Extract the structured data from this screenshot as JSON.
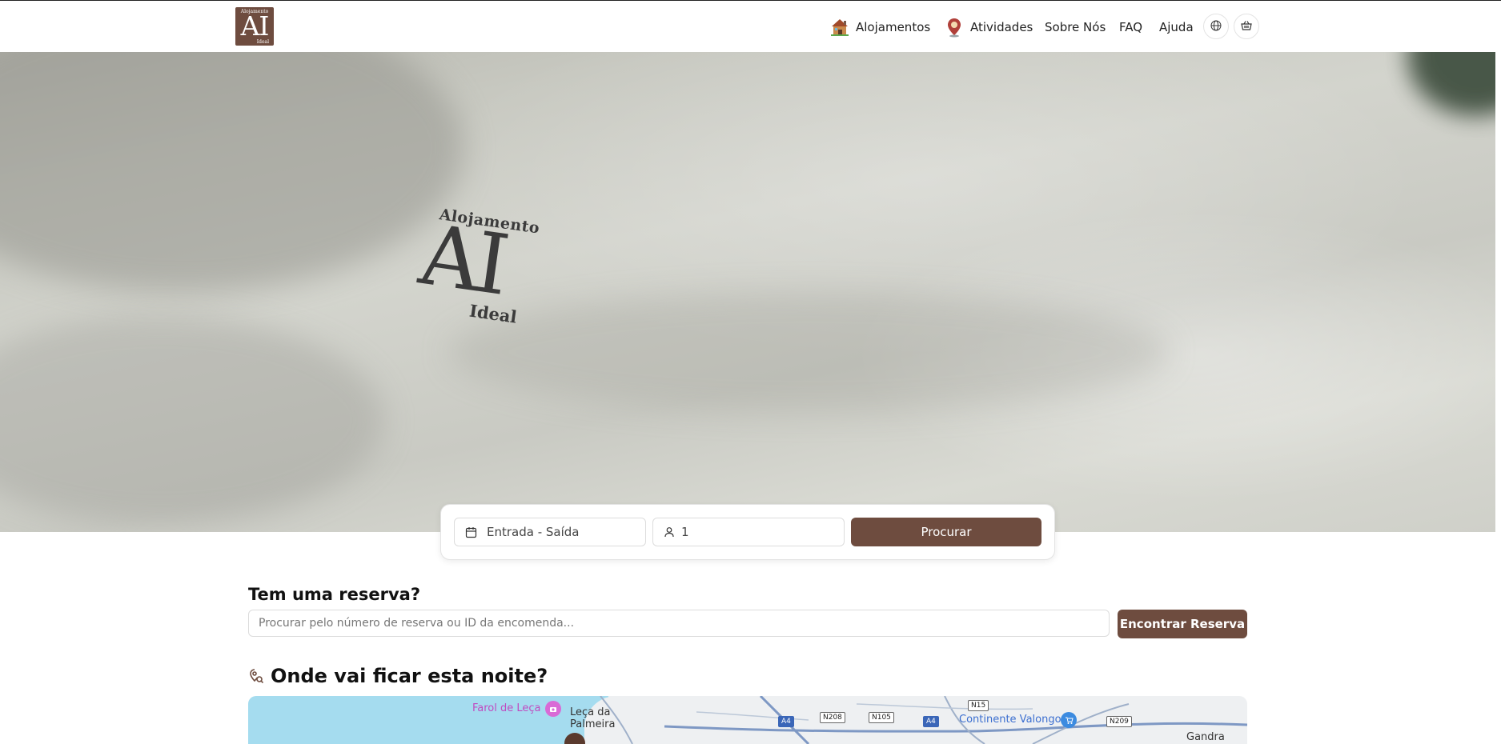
{
  "logo": {
    "top": "Alojamento",
    "main": "AI",
    "bottom": "Ideal"
  },
  "nav": {
    "items": [
      {
        "label": "Alojamentos",
        "icon": "house-icon"
      },
      {
        "label": "Atividades",
        "icon": "map-pin-icon"
      },
      {
        "label": "Sobre Nós"
      },
      {
        "label": "FAQ"
      },
      {
        "label": "Ajuda"
      }
    ],
    "language_icon": "globe-icon",
    "basket_icon": "basket-icon"
  },
  "hero": {
    "embroidery": {
      "top": "Alojamento",
      "main": "AI",
      "bottom": "Ideal"
    }
  },
  "search": {
    "dates_placeholder": "Entrada - Saída",
    "guests_value": "1",
    "search_button": "Procurar"
  },
  "reservation": {
    "title": "Tem uma reserva?",
    "placeholder": "Procurar pelo número de reserva ou ID da encomenda...",
    "button": "Encontrar Reserva"
  },
  "map_section": {
    "title": "Onde vai ficar esta noite?",
    "labels": {
      "farol": "Farol de Leça",
      "leca": "Leça da Palmeira",
      "continente": "Continente Valongo",
      "gandra": "Gandra"
    },
    "roads": [
      "N15",
      "N208",
      "N105",
      "A4",
      "A4",
      "N209"
    ]
  },
  "colors": {
    "brand": "#6e4c3f",
    "hero": "#cbccc5",
    "sea": "#a5dcef"
  }
}
